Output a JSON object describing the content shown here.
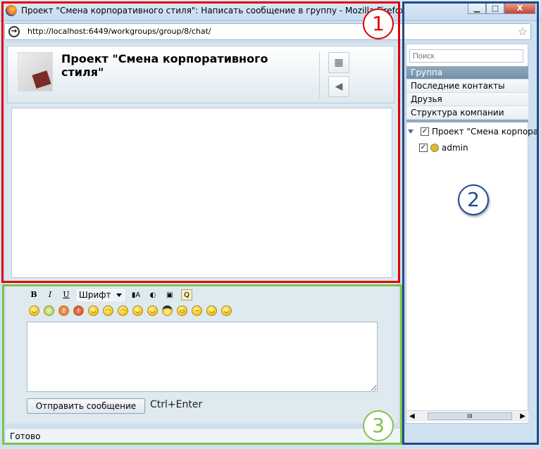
{
  "window": {
    "title": "Проект \"Смена корпоративного стиля\": Написать сообщение в группу - Mozilla Firefox",
    "min_label": "▁",
    "max_label": "□",
    "close_label": "X"
  },
  "urlbar": {
    "url": "http://localhost:6449/workgroups/group/8/chat/"
  },
  "header": {
    "project_title": "Проект \"Смена корпоративного стиля\""
  },
  "editor": {
    "bold": "B",
    "italic": "I",
    "underline": "U",
    "font_select": "Шрифт",
    "message_value": "",
    "send_button": "Отправить сообщение",
    "send_hint": "Ctrl+Enter"
  },
  "smileys": [
    "smile-big-icon",
    "bulb-icon",
    "question-icon",
    "exclamation-icon",
    "smile-icon",
    "sad-icon",
    "frown-icon",
    "blush-icon",
    "tongue-icon",
    "cool-icon",
    "grin-icon",
    "confused-icon",
    "happy-icon",
    "wink-icon"
  ],
  "status": {
    "text": "Готово"
  },
  "sidebar": {
    "search_placeholder": "Поиск",
    "menu": [
      "Группа",
      "Последние контакты",
      "Друзья",
      "Структура компании"
    ],
    "active_index": 0,
    "tree": {
      "group_label": "Проект \"Смена корпора",
      "members": [
        "admin"
      ]
    },
    "scroll_thumb": "III"
  },
  "badges": {
    "b1": "1",
    "b2": "2",
    "b3": "3"
  },
  "colors": {
    "region1": "#e00000",
    "region2": "#1f4b8c",
    "region3": "#7dc34a",
    "active_menu": "#7f99b0"
  }
}
